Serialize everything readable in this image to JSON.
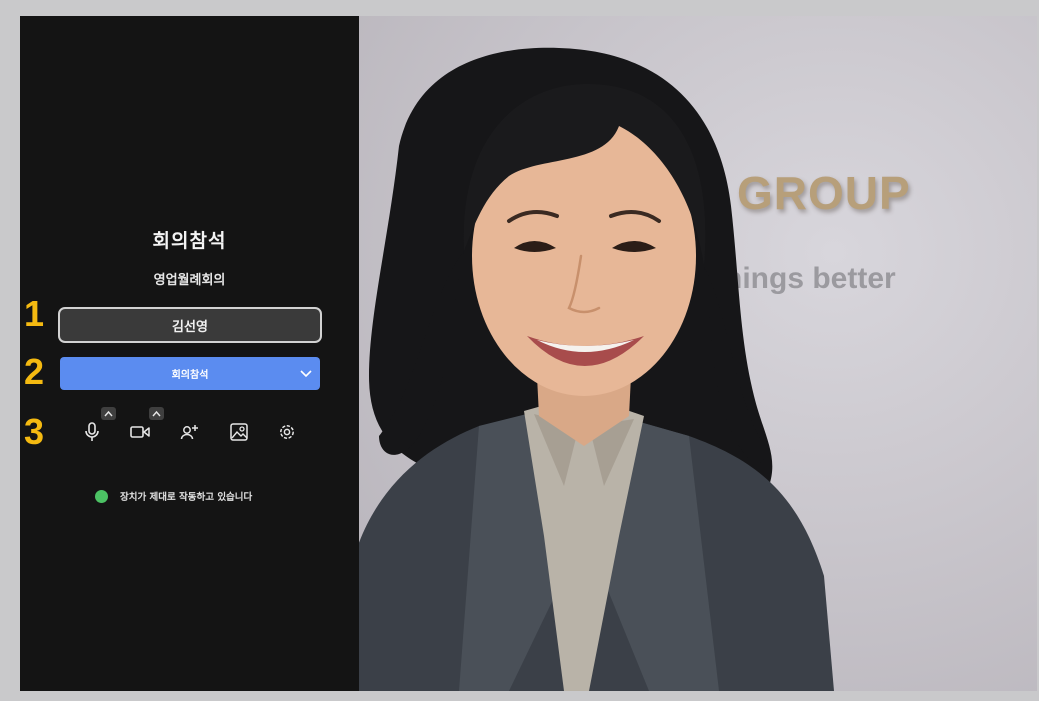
{
  "dialog": {
    "title": "회의참석",
    "meeting_name": "영업월례회의",
    "name_value": "김선영",
    "join_label": "회의참석",
    "status_text": "장치가 제대로 작동하고 있습니다"
  },
  "steps": [
    "1",
    "2",
    "3"
  ],
  "icons": [
    "microphone-icon",
    "video-camera-icon",
    "add-person-icon",
    "background-image-icon",
    "settings-icon",
    "chevron-down-icon",
    "chevron-up-icon"
  ],
  "preview": {
    "background_text_1": "N GROUP",
    "background_text_2": "e things better"
  },
  "colors": {
    "accent": "#5b8cf0",
    "status_ok": "#4cc264",
    "step_marker": "#f5ba11",
    "panel_bg": "#141414"
  }
}
